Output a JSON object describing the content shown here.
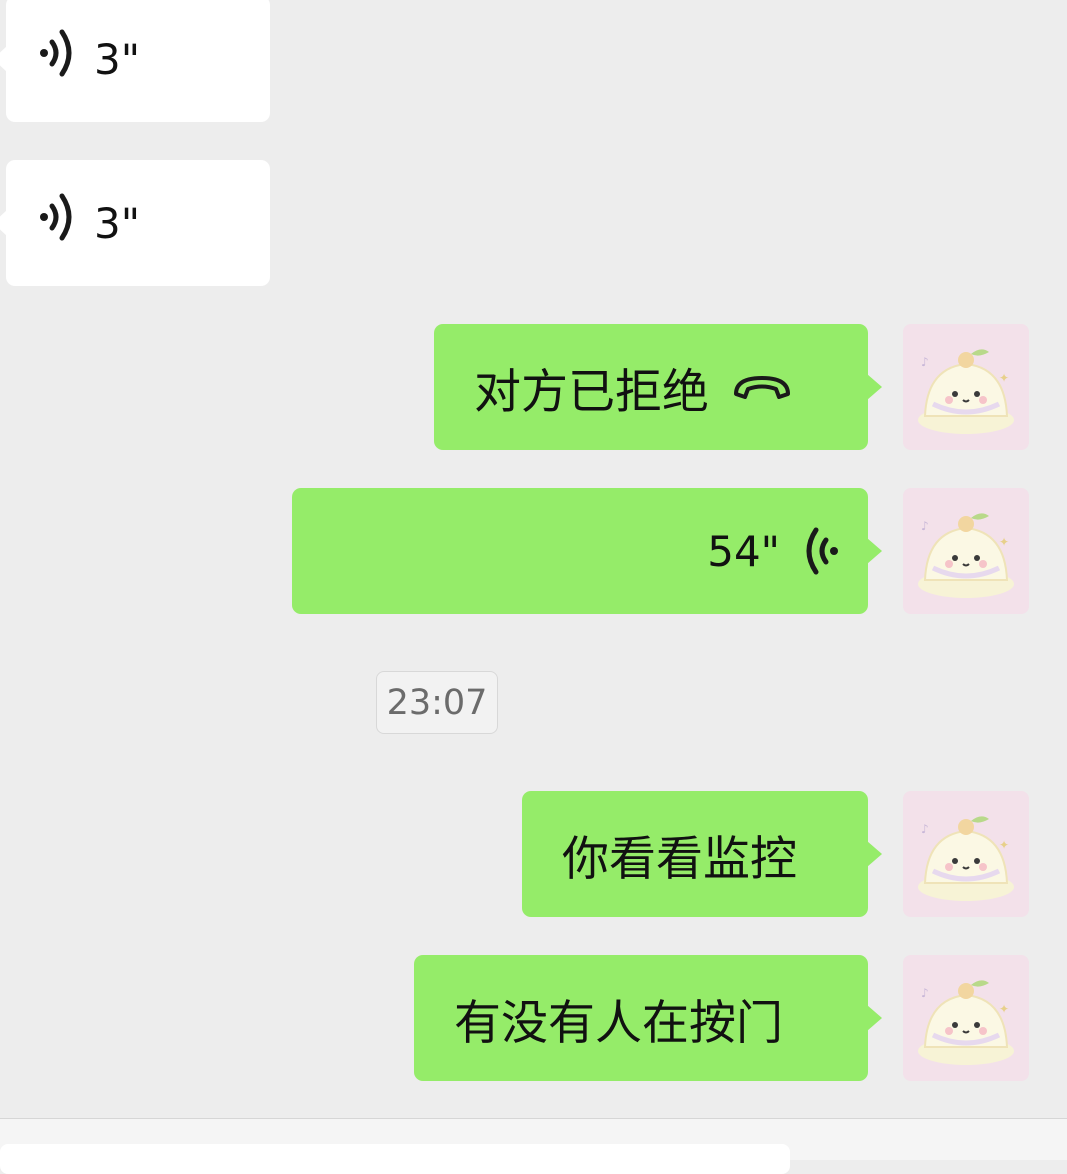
{
  "messages": {
    "voice_in_1": {
      "duration": "3\""
    },
    "voice_in_2": {
      "duration": "3\""
    },
    "call_declined": {
      "text": "对方已拒绝"
    },
    "voice_out": {
      "duration": "54\""
    },
    "timestamp": "23:07",
    "text_1": "你看看监控",
    "text_2": "有没有人在按门"
  },
  "colors": {
    "background": "#ededed",
    "bubble_out": "#95ec69",
    "bubble_in": "#ffffff"
  },
  "icons": {
    "voice_in": "voice-wave-icon",
    "voice_out": "voice-wave-icon",
    "call": "phone-hangup-icon",
    "avatar": "jelly-cat-avatar"
  }
}
